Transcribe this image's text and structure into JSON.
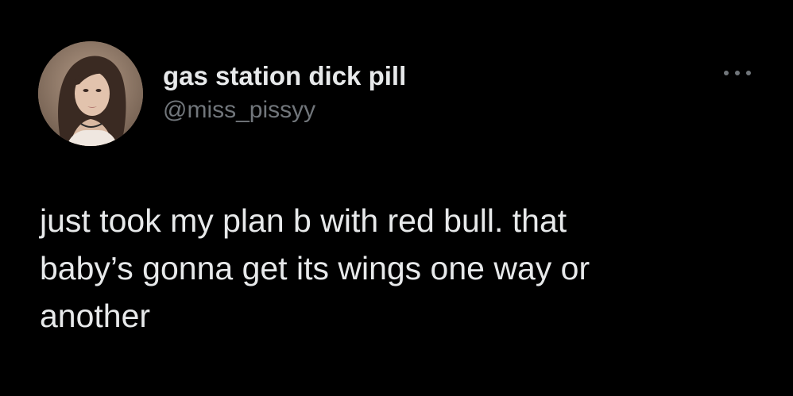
{
  "author": {
    "display_name": "gas station dick pill",
    "handle": "@miss_pissyy",
    "avatar_icon": "profile-photo"
  },
  "actions": {
    "more_icon": "more-horizontal-icon"
  },
  "tweet": {
    "text": "just took my plan b with red bull. that\nbaby’s gonna get its wings one way or\nanother"
  },
  "colors": {
    "background": "#000000",
    "primary_text": "#e7e9ea",
    "secondary_text": "#71767b"
  }
}
